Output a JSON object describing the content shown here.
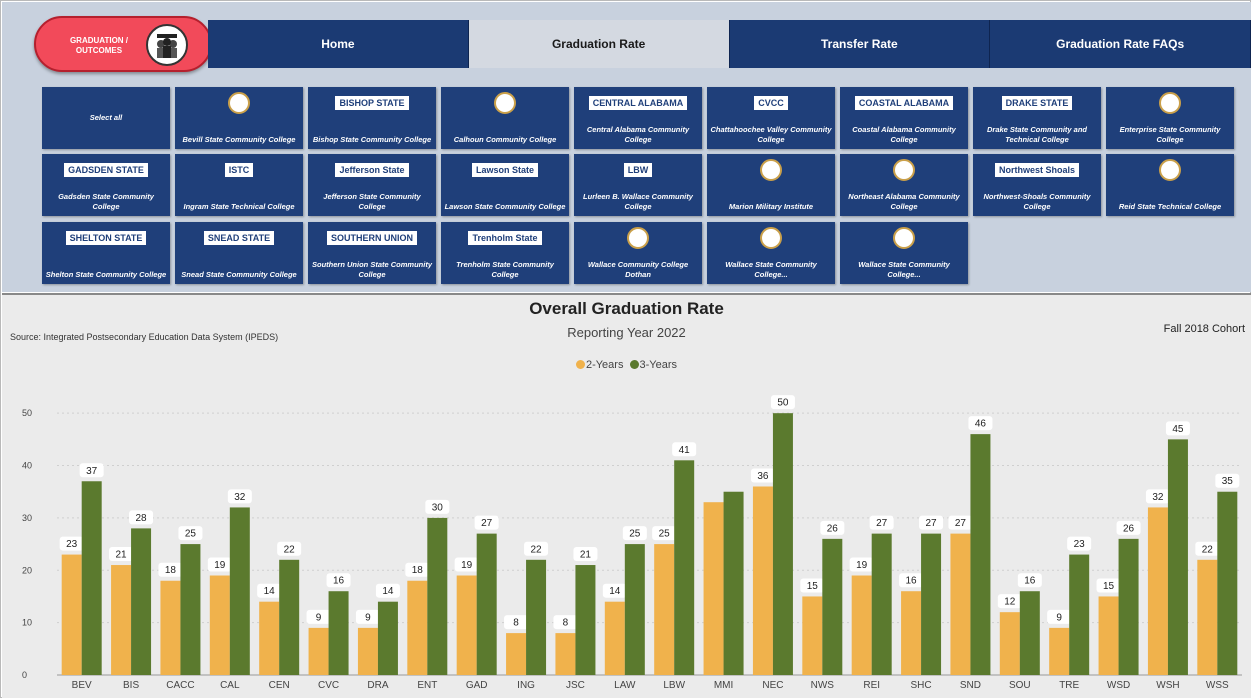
{
  "logo": {
    "line1": "GRADUATION /",
    "line2": "OUTCOMES",
    "icon": "graduates-icon"
  },
  "nav": [
    "Home",
    "Graduation Rate",
    "Transfer Rate",
    "Graduation Rate FAQs"
  ],
  "nav_active": "Graduation Rate",
  "colleges": [
    {
      "name": "Select all",
      "logo": ""
    },
    {
      "name": "Bevill State Community College",
      "logo": "seal"
    },
    {
      "name": "Bishop State Community College",
      "logo": "BISHOP STATE"
    },
    {
      "name": "Calhoun Community College",
      "logo": "flame"
    },
    {
      "name": "Central Alabama Community College",
      "logo": "CENTRAL ALABAMA"
    },
    {
      "name": "Chattahoochee Valley Community College",
      "logo": "CVCC"
    },
    {
      "name": "Coastal Alabama Community College",
      "logo": "COASTAL ALABAMA"
    },
    {
      "name": "Drake State Community and Technical College",
      "logo": "DRAKE STATE"
    },
    {
      "name": "Enterprise State Community College",
      "logo": "leaf"
    },
    {
      "name": "Gadsden State Community College",
      "logo": "GADSDEN STATE"
    },
    {
      "name": "Ingram State Technical College",
      "logo": "ISTC"
    },
    {
      "name": "Jefferson State Community College",
      "logo": "Jefferson State"
    },
    {
      "name": "Lawson State Community College",
      "logo": "Lawson State"
    },
    {
      "name": "Lurleen B. Wallace Community College",
      "logo": "LBW"
    },
    {
      "name": "Marion Military Institute",
      "logo": "seal"
    },
    {
      "name": "Northeast Alabama Community College",
      "logo": "bird"
    },
    {
      "name": "Northwest-Shoals Community College",
      "logo": "Northwest Shoals"
    },
    {
      "name": "Reid State Technical College",
      "logo": "seal"
    },
    {
      "name": "Shelton State Community College",
      "logo": "SHELTON STATE"
    },
    {
      "name": "Snead State Community College",
      "logo": "SNEAD STATE"
    },
    {
      "name": "Southern Union State Community College",
      "logo": "SOUTHERN UNION"
    },
    {
      "name": "Trenholm State Community College",
      "logo": "Trenholm State"
    },
    {
      "name": "Wallace Community College Dothan",
      "logo": "W"
    },
    {
      "name": "Wallace State Community College...",
      "logo": "seal"
    },
    {
      "name": "Wallace State Community College...",
      "logo": "seal"
    }
  ],
  "colors": {
    "two_year": "#f0b24c",
    "three_year": "#5b7a2e",
    "nav_bg": "#1b3a73",
    "tile_bg": "#1f3f7a"
  },
  "chart_data": {
    "type": "bar",
    "title": "Overall Graduation Rate",
    "subtitle": "Reporting Year 2022",
    "source": "Source: Integrated Postsecondary Education Data System (IPEDS)",
    "cohort": "Fall 2018 Cohort",
    "categories": [
      "BEV",
      "BIS",
      "CACC",
      "CAL",
      "CEN",
      "CVC",
      "DRA",
      "ENT",
      "GAD",
      "ING",
      "JSC",
      "LAW",
      "LBW",
      "MMI",
      "NEC",
      "NWS",
      "REI",
      "SHC",
      "SND",
      "SOU",
      "TRE",
      "WSD",
      "WSH",
      "WSS"
    ],
    "series": [
      {
        "name": "2-Years",
        "color": "#f0b24c",
        "values": [
          23,
          21,
          18,
          19,
          14,
          9,
          9,
          18,
          19,
          8,
          8,
          14,
          25,
          33,
          36,
          15,
          19,
          16,
          27,
          12,
          9,
          15,
          32,
          22
        ]
      },
      {
        "name": "3-Years",
        "color": "#5b7a2e",
        "values": [
          37,
          28,
          25,
          32,
          22,
          16,
          14,
          30,
          27,
          22,
          21,
          25,
          41,
          35,
          50,
          26,
          27,
          27,
          46,
          16,
          23,
          26,
          45,
          35
        ]
      }
    ],
    "show_labels": [
      [
        true,
        true,
        true,
        true,
        true,
        true,
        true,
        true,
        true,
        true,
        true,
        true,
        true,
        false,
        true,
        true,
        true,
        true,
        true,
        true,
        true,
        true,
        true,
        true
      ],
      [
        true,
        true,
        true,
        true,
        true,
        true,
        true,
        true,
        true,
        true,
        true,
        true,
        true,
        false,
        true,
        true,
        true,
        true,
        true,
        true,
        true,
        true,
        true,
        true
      ]
    ],
    "y_ticks": [
      0,
      10,
      20,
      30,
      40,
      50
    ],
    "ylim": [
      0,
      55
    ],
    "grid": true,
    "legend": "top-center"
  }
}
